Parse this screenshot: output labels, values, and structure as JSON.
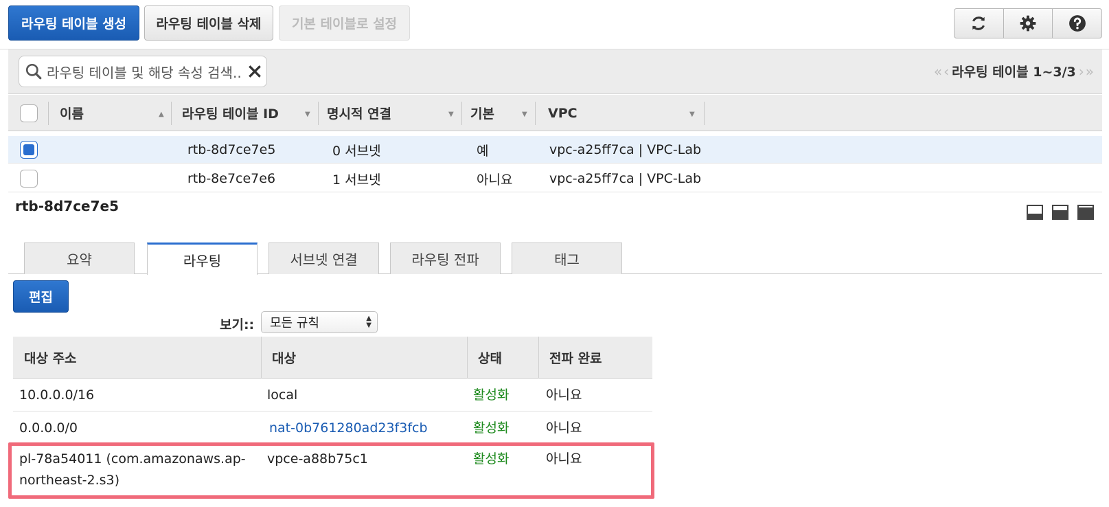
{
  "toolbar": {
    "create_label": "라우팅 테이블 생성",
    "delete_label": "라우팅 테이블 삭제",
    "set_default_label": "기본 테이블로 설정"
  },
  "search": {
    "placeholder": "라우팅 테이블 및 해당 속성 검색.."
  },
  "pager": {
    "label": "라우팅 테이블 1~3/3"
  },
  "table": {
    "headers": {
      "name": "이름",
      "id": "라우팅 테이블 ID",
      "explicit": "명시적 연결",
      "main": "기본",
      "vpc": "VPC"
    },
    "rows": [
      {
        "id": "rtb-8d7ce7e5",
        "explicit": "0 서브넷",
        "main": "예",
        "vpc": "vpc-a25ff7ca | VPC-Lab",
        "selected": true
      },
      {
        "id": "rtb-8e7ce7e6",
        "explicit": "1 서브넷",
        "main": "아니요",
        "vpc": "vpc-a25ff7ca | VPC-Lab",
        "selected": false
      }
    ]
  },
  "detail": {
    "title": "rtb-8d7ce7e5",
    "tabs": [
      {
        "label": "요약"
      },
      {
        "label": "라우팅",
        "active": true
      },
      {
        "label": "서브넷 연결"
      },
      {
        "label": "라우팅 전파"
      },
      {
        "label": "태그"
      }
    ],
    "edit_label": "편집",
    "view_label": "보기::",
    "view_value": "모든 규칙"
  },
  "routes": {
    "headers": {
      "destination": "대상 주소",
      "target": "대상",
      "status": "상태",
      "propagated": "전파 완료"
    },
    "rows": [
      {
        "destination": "10.0.0.0/16",
        "target": "local",
        "status": "활성화",
        "propagated": "아니요"
      },
      {
        "destination": "0.0.0.0/0",
        "target": "nat-0b761280ad23f3fcb",
        "status": "활성화",
        "propagated": "아니요"
      },
      {
        "destination": "pl-78a54011 (com.amazonaws.ap-northeast-2.s3)",
        "destination_line1": "pl-78a54011 (com.amazonaws.ap-",
        "destination_line2": "northeast-2.s3)",
        "target": "vpce-a88b75c1",
        "status": "활성화",
        "propagated": "아니요"
      }
    ]
  },
  "colors": {
    "primary": "#1a5cb3",
    "active_status": "#1d8a1d",
    "highlight": "#f06a7a"
  }
}
